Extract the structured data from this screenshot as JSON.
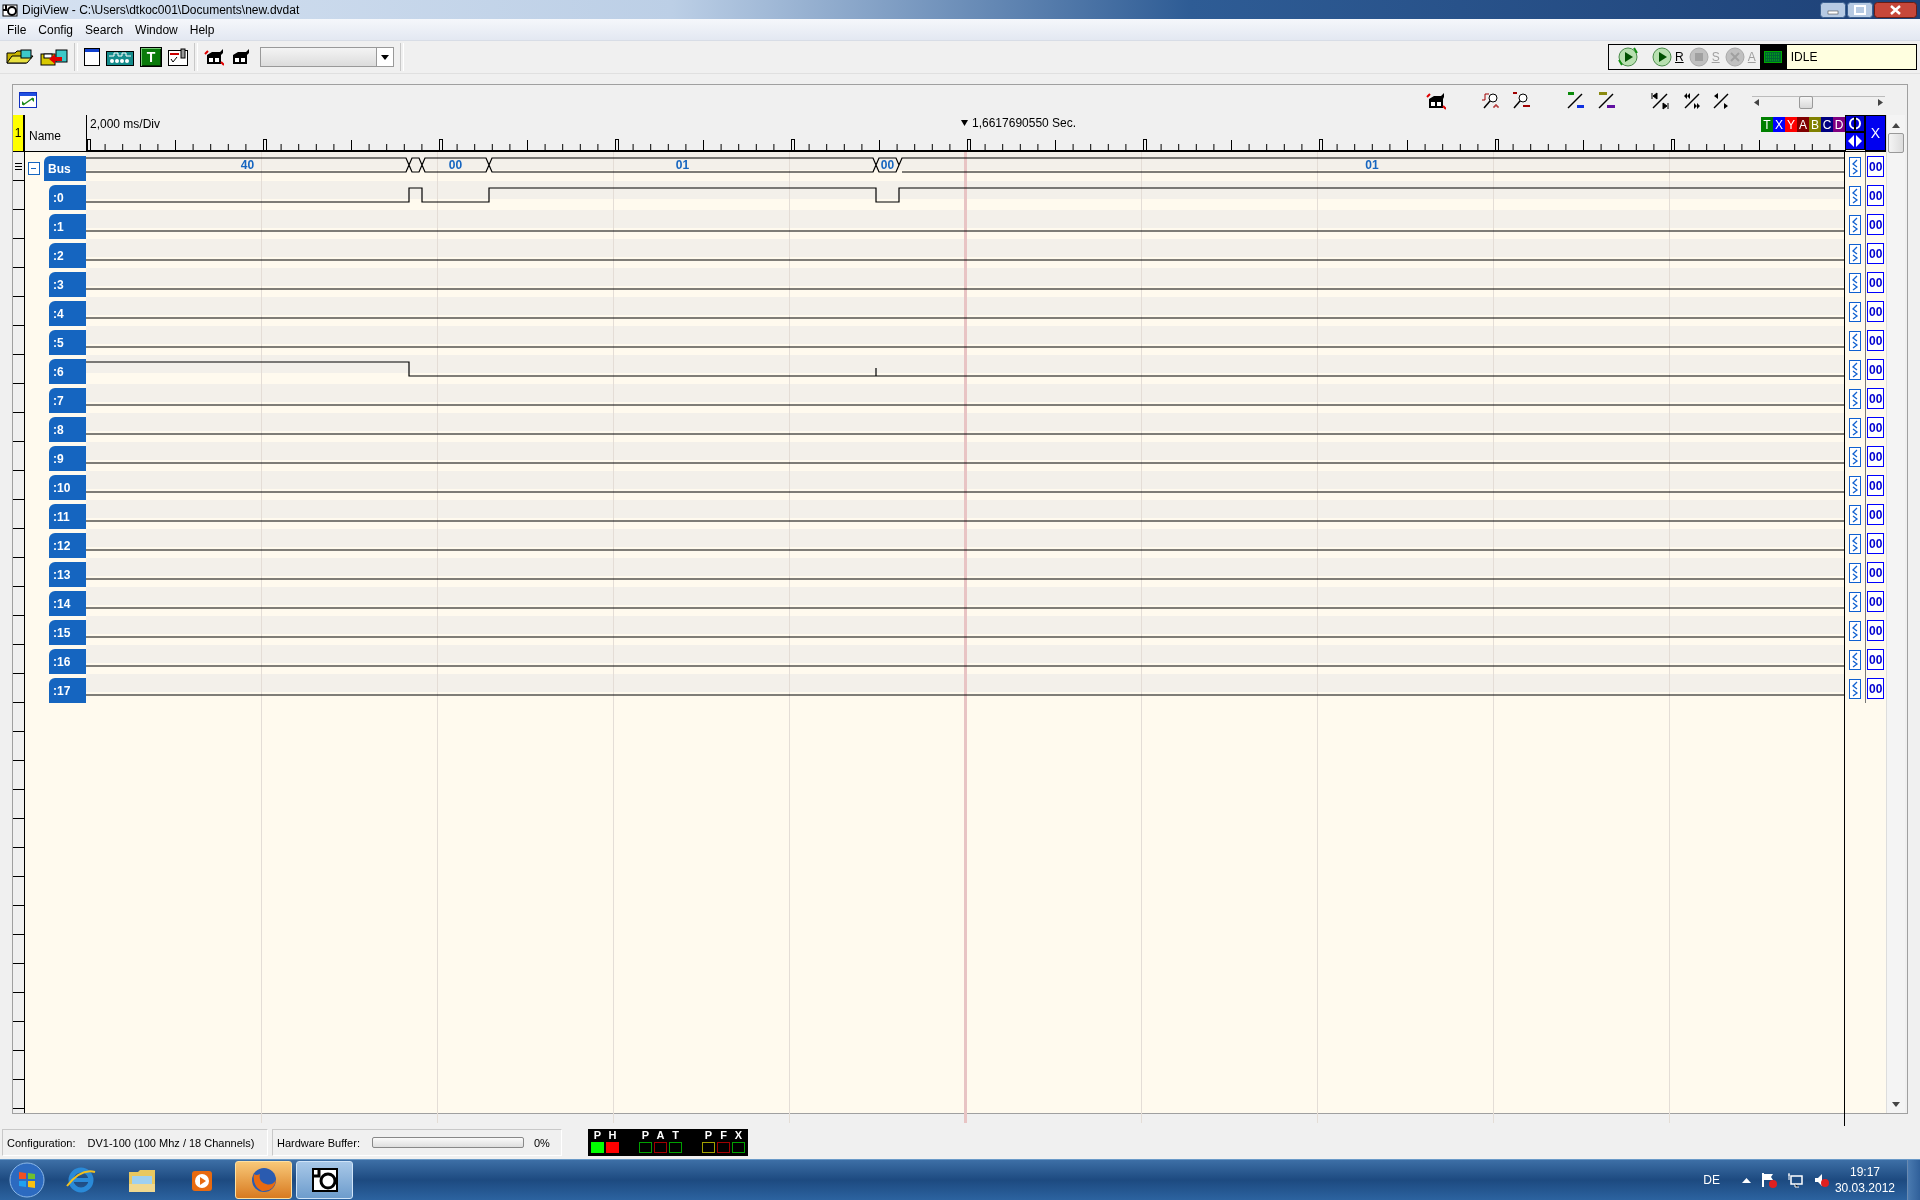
{
  "window": {
    "title": "DigiView - C:\\Users\\dtkoc001\\Documents\\new.dvdat"
  },
  "menu": [
    "File",
    "Config",
    "Search",
    "Window",
    "Help"
  ],
  "toolbar": {
    "text_tool": "T"
  },
  "run_controls": [
    {
      "label": "R",
      "disabled": false
    },
    {
      "label": "S",
      "disabled": true
    },
    {
      "label": "A",
      "disabled": true
    }
  ],
  "status_text": "IDLE",
  "panel": {
    "row_marker": "1",
    "name_header": "Name",
    "scale": "2,000 ms/Div",
    "cursor_time": "1,6617690550 Sec.",
    "cursors": [
      {
        "label": "T",
        "color": "#008000"
      },
      {
        "label": "X",
        "color": "#0000ff"
      },
      {
        "label": "Y",
        "color": "#ff0000"
      },
      {
        "label": "A",
        "color": "#800000"
      },
      {
        "label": "B",
        "color": "#808000"
      },
      {
        "label": "C",
        "color": "#000080"
      },
      {
        "label": "D",
        "color": "#800080"
      }
    ],
    "close_label": "X",
    "bus": {
      "name": "Bus",
      "expanded": true,
      "format": "00",
      "values": [
        "40",
        "00",
        "01",
        "00",
        "01"
      ]
    },
    "channels": [
      {
        "name": ":0",
        "format": "00"
      },
      {
        "name": ":1",
        "format": "00"
      },
      {
        "name": ":2",
        "format": "00"
      },
      {
        "name": ":3",
        "format": "00"
      },
      {
        "name": ":4",
        "format": "00"
      },
      {
        "name": ":5",
        "format": "00"
      },
      {
        "name": ":6",
        "format": "00"
      },
      {
        "name": ":7",
        "format": "00"
      },
      {
        "name": ":8",
        "format": "00"
      },
      {
        "name": ":9",
        "format": "00"
      },
      {
        "name": ":10",
        "format": "00"
      },
      {
        "name": ":11",
        "format": "00"
      },
      {
        "name": ":12",
        "format": "00"
      },
      {
        "name": ":13",
        "format": "00"
      },
      {
        "name": ":14",
        "format": "00"
      },
      {
        "name": ":15",
        "format": "00"
      },
      {
        "name": ":16",
        "format": "00"
      },
      {
        "name": ":17",
        "format": "00"
      }
    ]
  },
  "status_bar": {
    "config_label": "Configuration:",
    "config_value": "DV1-100 (100 Mhz / 18 Channels)",
    "buffer_label": "Hardware Buffer:",
    "buffer": {
      "level": 0
    },
    "buffer_reading": "0%",
    "indicator_groups": [
      {
        "lamps": [
          {
            "label": "P",
            "on": true,
            "color": "#00ff00"
          },
          {
            "label": "H",
            "on": true,
            "color": "#ff0000"
          }
        ]
      },
      {
        "lamps": [
          {
            "label": "P",
            "on": false,
            "color": "#00a000"
          },
          {
            "label": "A",
            "on": false,
            "color": "#a00000"
          },
          {
            "label": "T",
            "on": false,
            "color": "#00a000"
          }
        ]
      },
      {
        "lamps": [
          {
            "label": "P",
            "on": false,
            "color": "#a0a000"
          },
          {
            "label": "F",
            "on": false,
            "color": "#a00000"
          },
          {
            "label": "X",
            "on": false,
            "color": "#00a000"
          }
        ]
      }
    ]
  },
  "taskbar": {
    "apps": [
      {
        "kind": "browser-e",
        "selected": false,
        "flashing": false
      },
      {
        "kind": "folder",
        "selected": false,
        "flashing": false
      },
      {
        "kind": "player",
        "selected": false,
        "flashing": false
      },
      {
        "kind": "browser-fox",
        "selected": false,
        "flashing": true
      },
      {
        "kind": "scope",
        "selected": true,
        "flashing": false
      }
    ],
    "language": "DE",
    "time": "19:17",
    "date": "30.03.2012"
  }
}
